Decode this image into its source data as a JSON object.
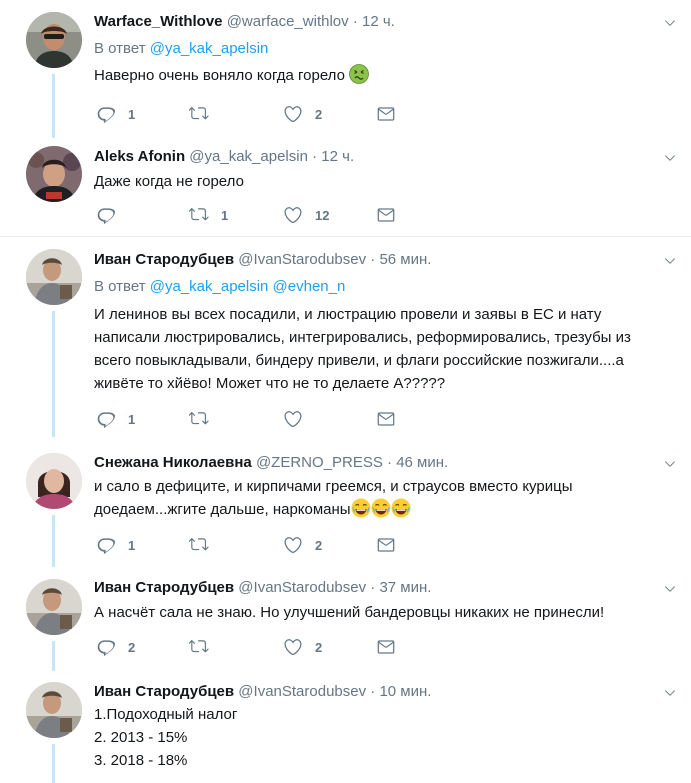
{
  "tweets": [
    {
      "name": "Warface_Withlove",
      "handle": "@warface_withlov",
      "time": "12 ч.",
      "reply_prefix": "В ответ",
      "reply_mentions": "@ya_kak_apelsin",
      "text": "Наверно очень воняло когда горело",
      "replies": "1",
      "retweets": "",
      "likes": "2"
    },
    {
      "name": "Aleks Afonin",
      "handle": "@ya_kak_apelsin",
      "time": "12 ч.",
      "text": "Даже когда не горело",
      "replies": "",
      "retweets": "1",
      "likes": "12"
    },
    {
      "name": "Иван Стародубцев",
      "handle": "@IvanStarodubsev",
      "time": "56 мин.",
      "reply_prefix": "В ответ",
      "reply_mentions": "@ya_kak_apelsin @evhen_n",
      "text_lines": [
        "И ленинов вы всех посадили, и люстрацию провели и заявы в ЕС и нату",
        "написали люстрировались, интегрировались, реформировались, трезубы из",
        "всего повыкладывали, биндеру привели, и флаги российские позжигали....а",
        "живёте то хйёво! Может что не то делаете А?????"
      ],
      "replies": "1",
      "retweets": "",
      "likes": ""
    },
    {
      "name": "Снежана Николаевна",
      "handle": "@ZERNO_PRESS",
      "time": "46 мин.",
      "text_lines": [
        "и сало в дефиците, и кирпичами греемся, и страусов вместо курицы",
        "доедаем...жгите дальше, наркоманы"
      ],
      "replies": "1",
      "retweets": "",
      "likes": "2"
    },
    {
      "name": "Иван Стародубцев",
      "handle": "@IvanStarodubsev",
      "time": "37 мин.",
      "text": "А насчёт сала не знаю. Но улучшений бандеровцы никаких не принесли!",
      "replies": "2",
      "retweets": "",
      "likes": "2"
    },
    {
      "name": "Иван Стародубцев",
      "handle": "@IvanStarodubsev",
      "time": "10 мин.",
      "text_lines": [
        "1.Подоходный налог",
        "2. 2013 - 15%",
        "3. 2018 - 18%"
      ]
    }
  ],
  "colors": {
    "accent": "#1da1f2",
    "thread_line": "#c4e7f6",
    "muted": "#657786",
    "divider": "#e6ecf0"
  },
  "icons": {
    "reply": "reply-icon",
    "retweet": "retweet-icon",
    "like": "heart-icon",
    "dm": "envelope-icon",
    "caret": "chevron-down-icon",
    "nauseated": "nauseated-face-emoji",
    "laughing": "tears-of-joy-emoji"
  }
}
